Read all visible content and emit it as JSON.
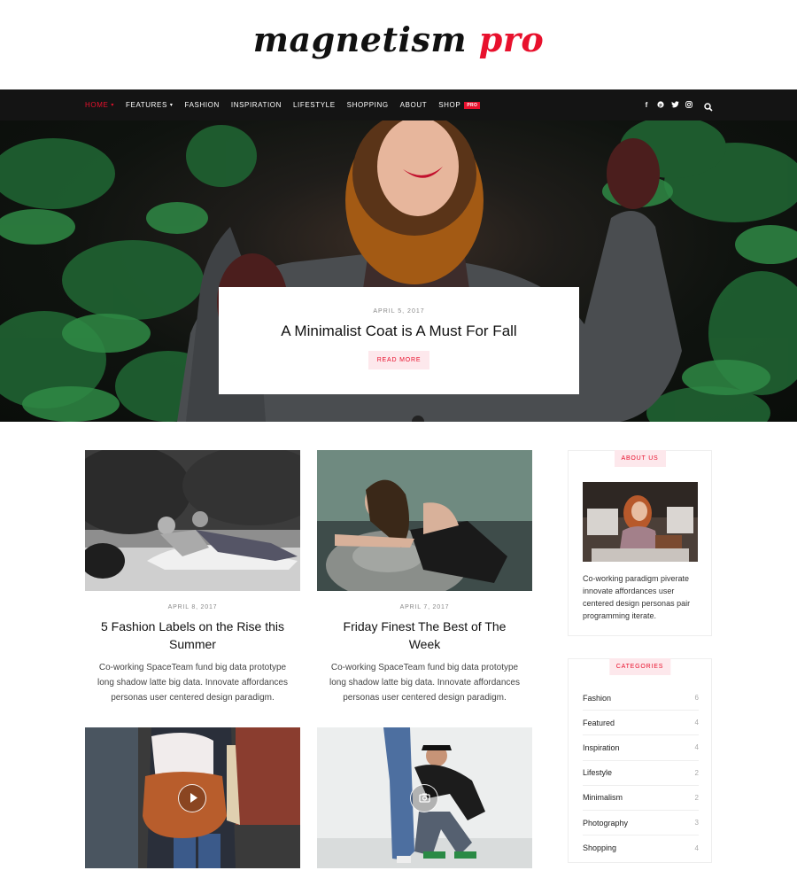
{
  "brand": {
    "logo_part1": "magnetism",
    "logo_part2": " pro",
    "accent_color": "#e8112d"
  },
  "nav": {
    "items": [
      {
        "label": "HOME",
        "active": true,
        "dropdown": true
      },
      {
        "label": "FEATURES",
        "dropdown": true
      },
      {
        "label": "FASHION"
      },
      {
        "label": "INSPIRATION"
      },
      {
        "label": "LIFESTYLE"
      },
      {
        "label": "SHOPPING"
      },
      {
        "label": "ABOUT"
      },
      {
        "label": "SHOP",
        "badge": "PRO"
      }
    ],
    "social_icons": [
      "facebook-icon",
      "pinterest-icon",
      "twitter-icon",
      "instagram-icon"
    ],
    "search_icon": "search-icon"
  },
  "hero": {
    "date": "APRIL 5, 2017",
    "title": "A Minimalist Coat is A Must For Fall",
    "button": "READ MORE"
  },
  "posts": [
    {
      "date": "APRIL 8, 2017",
      "title": "5 Fashion Labels on the Rise this Summer",
      "excerpt": "Co-working SpaceTeam fund big data prototype long shadow latte big data. Innovate affordances personas user centered design paradigm."
    },
    {
      "date": "APRIL 7, 2017",
      "title": "Friday Finest The Best of The Week",
      "excerpt": "Co-working SpaceTeam fund big data prototype long shadow latte big data. Innovate affordances personas user centered design paradigm."
    },
    {
      "media": "play-icon"
    },
    {
      "media": "camera-icon"
    }
  ],
  "sidebar": {
    "about": {
      "title": "ABOUT US",
      "text": "Co-working paradigm piverate innovate affordances user centered design personas pair programming iterate."
    },
    "categories": {
      "title": "CATEGORIES",
      "items": [
        {
          "name": "Fashion",
          "count": "6"
        },
        {
          "name": "Featured",
          "count": "4"
        },
        {
          "name": "Inspiration",
          "count": "4"
        },
        {
          "name": "Lifestyle",
          "count": "2"
        },
        {
          "name": "Minimalism",
          "count": "2"
        },
        {
          "name": "Photography",
          "count": "3"
        },
        {
          "name": "Shopping",
          "count": "4"
        }
      ]
    }
  }
}
